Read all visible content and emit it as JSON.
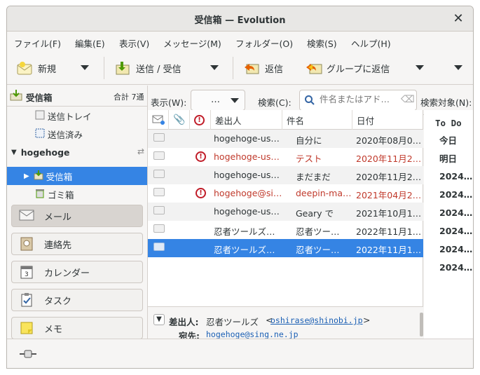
{
  "window": {
    "title": "受信箱 — Evolution"
  },
  "menu": [
    "ファイル(F)",
    "編集(E)",
    "表示(V)",
    "メッセージ(M)",
    "フォルダー(O)",
    "検索(S)",
    "ヘルプ(H)"
  ],
  "toolbar": {
    "new_label": "新規",
    "send_receive_label": "送信 / 受信",
    "reply_label": "返信",
    "reply_group_label": "グループに返信"
  },
  "sidebar": {
    "header_title": "受信箱",
    "header_count": "合計 7通",
    "folders": [
      {
        "label": "送信トレイ"
      },
      {
        "label": "送信済み"
      }
    ],
    "account": "hogehoge",
    "account_folders": [
      {
        "label": "受信箱"
      },
      {
        "label": "ゴミ箱"
      }
    ],
    "nav": [
      "メール",
      "連絡先",
      "カレンダー",
      "タスク",
      "メモ"
    ]
  },
  "filter": {
    "show_label": "表示(W):",
    "show_value": "…",
    "search_label": "検索(C):",
    "search_placeholder": "件名またはアド…",
    "search_target_label": "検索対象(N):"
  },
  "columns": {
    "from": "差出人",
    "subject": "件名",
    "date": "日付"
  },
  "messages": [
    {
      "from": "hogehoge-us…",
      "subject": "自分に",
      "date": "2020年08月0…",
      "important": false,
      "red": false
    },
    {
      "from": "hogehoge-us…",
      "subject": "テスト",
      "date": "2020年11月2…",
      "important": true,
      "red": true
    },
    {
      "from": "hogehoge-us…",
      "subject": "まだまだ",
      "date": "2020年11月2…",
      "important": false,
      "red": false
    },
    {
      "from": "hogehoge@si…",
      "subject": "deepin-ma…",
      "date": "2021年04月2…",
      "important": true,
      "red": true
    },
    {
      "from": "hogehoge-us…",
      "subject": "Geary で",
      "date": "2021年10月1…",
      "important": false,
      "red": false
    },
    {
      "from": "忍者ツールズ…",
      "subject": "忍者ツー…",
      "date": "2022年11月1…",
      "important": false,
      "red": false
    },
    {
      "from": "忍者ツールズ…",
      "subject": "忍者ツー…",
      "date": "2022年11月1…",
      "important": false,
      "red": false
    }
  ],
  "todo": {
    "title": "To Do",
    "items": [
      "今日",
      "明日",
      "2024…",
      "2024…",
      "2024…",
      "2024…",
      "2024…",
      "2024…"
    ]
  },
  "preview": {
    "from_label": "差出人:",
    "from_name": "忍者ツールズ",
    "from_email": "oshirase@shinobi.jp",
    "to_label": "宛先:",
    "to_email": "hogehoge@sing.ne.jp"
  },
  "colors": {
    "accent": "#3584e4",
    "important": "#c01c28",
    "link": "#1a5fb4"
  }
}
